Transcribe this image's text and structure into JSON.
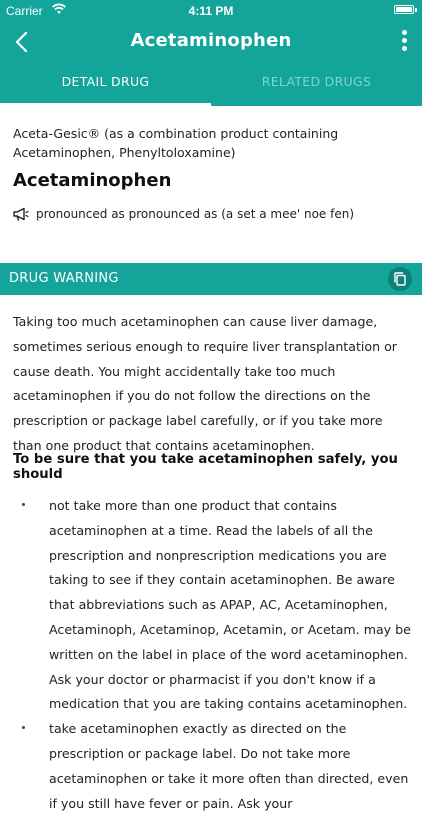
{
  "status_bar": {
    "carrier": "Carrier",
    "time": "4:11 PM"
  },
  "nav": {
    "title": "Acetaminophen",
    "back_icon": "chevron-left-icon",
    "menu_icon": "more-vertical-icon"
  },
  "tabs": [
    {
      "label": "DETAIL DRUG",
      "active": true
    },
    {
      "label": "RELATED DRUGS",
      "active": false
    }
  ],
  "detail": {
    "brand_line": "Aceta-Gesic® (as a combination product containing Acetaminophen, Phenyltoloxamine)",
    "drug_name": "Acetaminophen",
    "pronunciation": "pronounced as pronounced as (a set a mee' noe fen)"
  },
  "warning": {
    "title": "DRUG WARNING",
    "paragraph": "Taking too much acetaminophen can cause liver damage, sometimes serious enough to require liver transplantation or cause death. You might accidentally take too much acetaminophen if you do not follow the directions on the prescription or package label carefully, or if you take more than one product that contains acetaminophen.",
    "subheading": "To be sure that you take acetaminophen safely, you should",
    "bullets": [
      "not take more than one product that contains acetaminophen at a time. Read the labels of all the prescription and nonprescription medications you are taking to see if they contain acetaminophen. Be aware that abbreviations such as APAP, AC, Acetaminophen, Acetaminoph, Acetaminop, Acetamin, or Acetam. may be written on the label in place of the word acetaminophen. Ask your doctor or pharmacist if you don't know if a medication that you are taking contains acetaminophen.",
      "take acetaminophen exactly as directed on the prescription or package label. Do not take more acetaminophen or take it more often than directed, even if you still have fever or pain. Ask your"
    ]
  },
  "colors": {
    "primary": "#13a49a",
    "primary_dark": "#0e827a",
    "tab_inactive": "#7fd4cd"
  }
}
